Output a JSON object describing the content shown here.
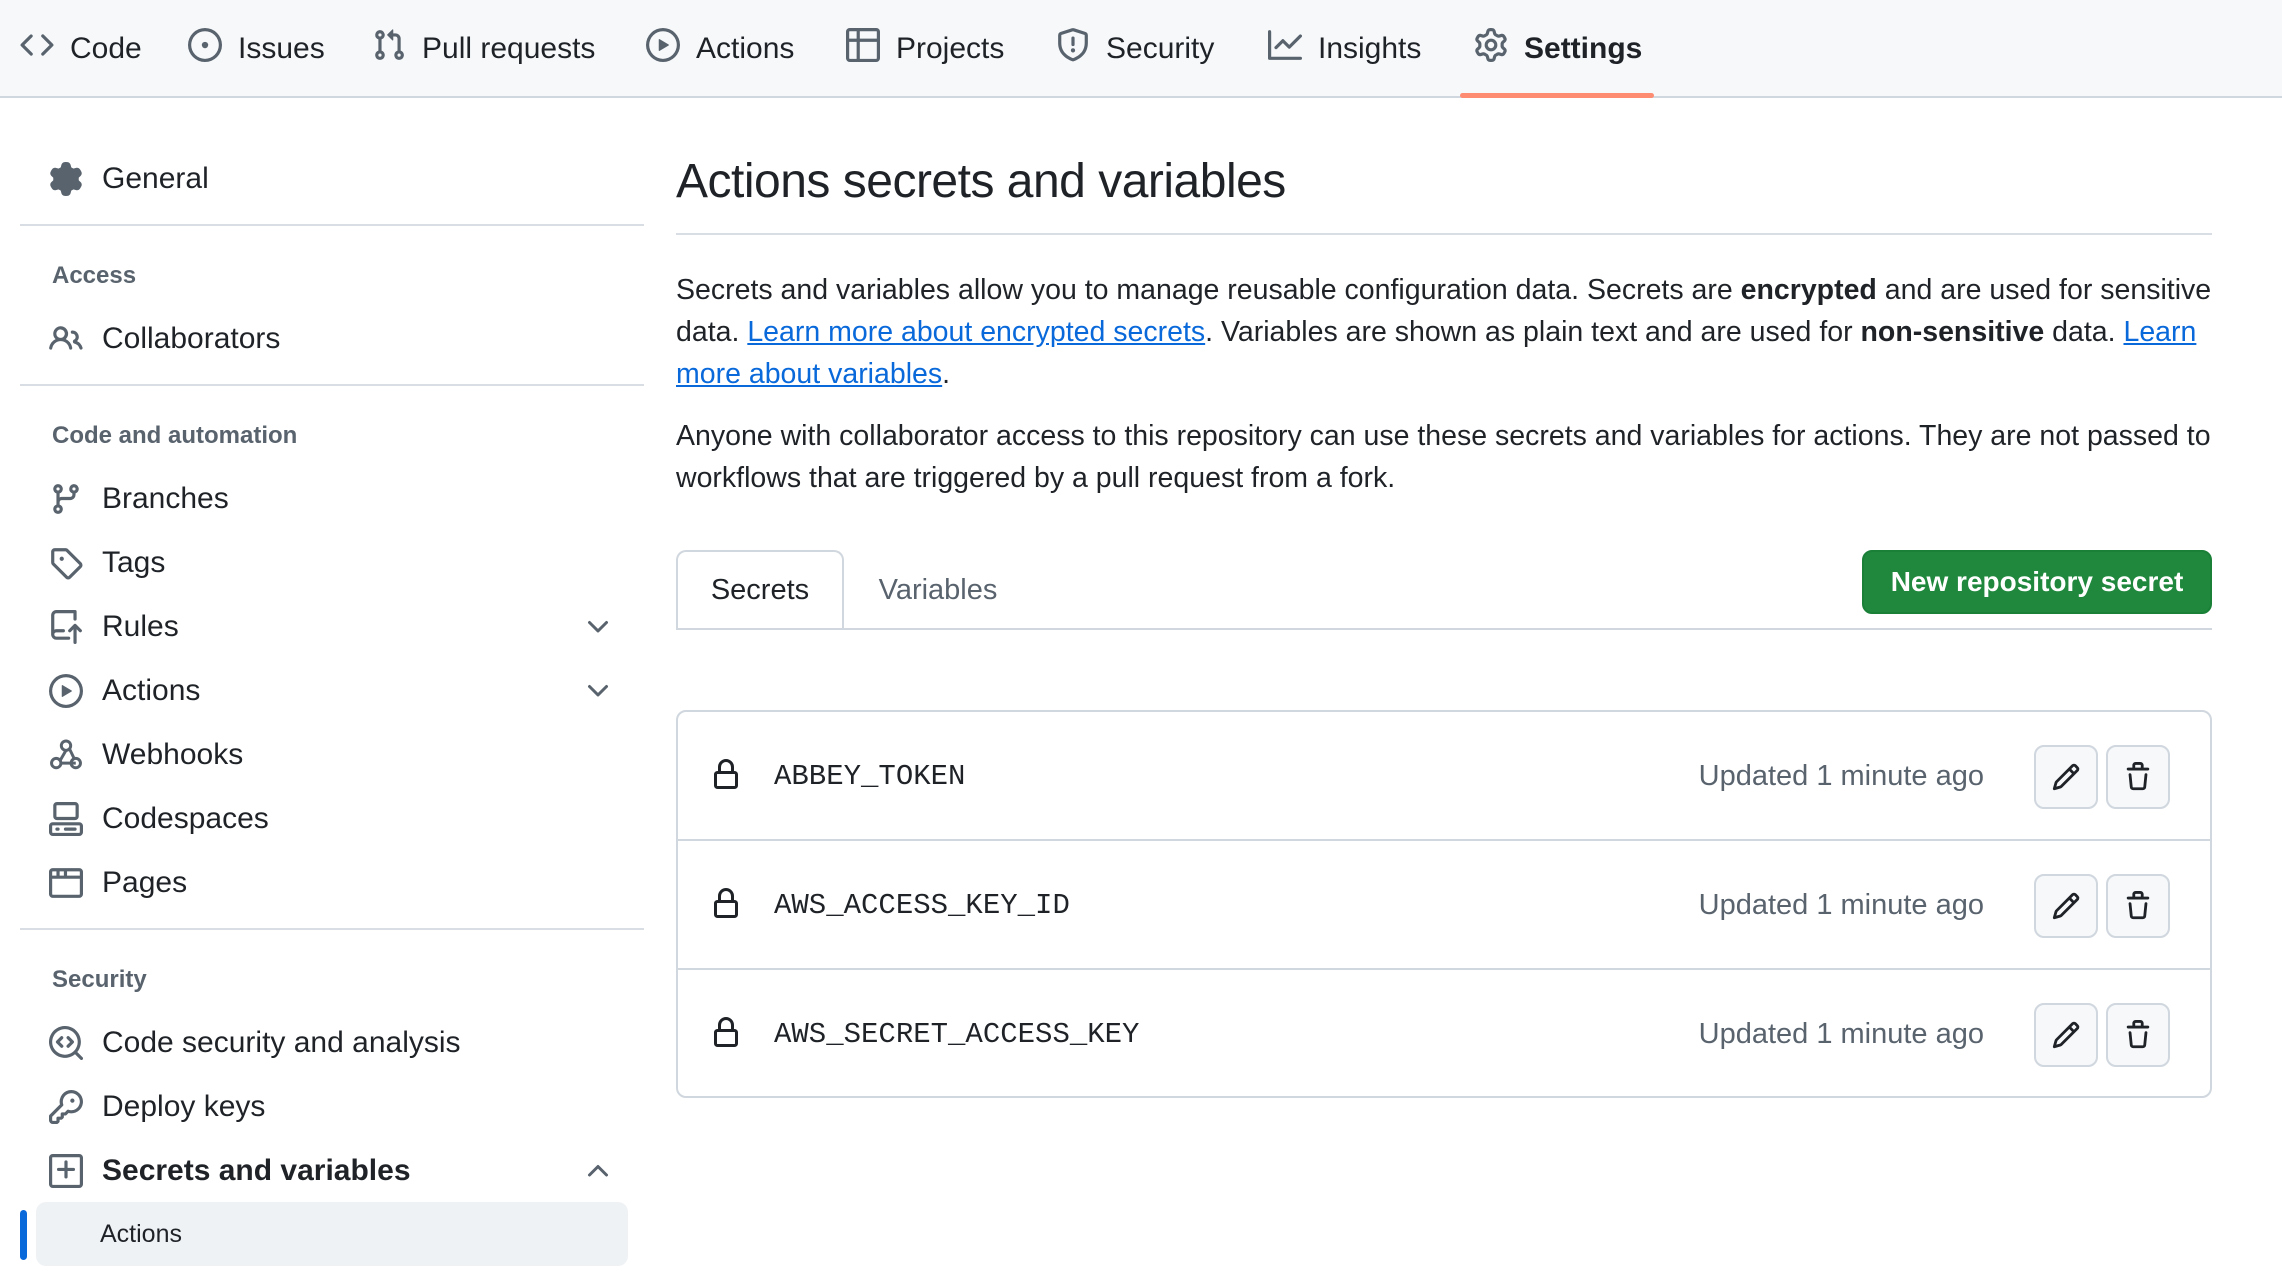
{
  "topnav": {
    "tabs": [
      {
        "label": "Code",
        "icon": "code-icon"
      },
      {
        "label": "Issues",
        "icon": "issue-opened-icon"
      },
      {
        "label": "Pull requests",
        "icon": "git-pull-request-icon"
      },
      {
        "label": "Actions",
        "icon": "play-icon"
      },
      {
        "label": "Projects",
        "icon": "table-icon"
      },
      {
        "label": "Security",
        "icon": "shield-icon"
      },
      {
        "label": "Insights",
        "icon": "graph-icon"
      },
      {
        "label": "Settings",
        "icon": "gear-icon"
      }
    ],
    "selected": "Settings",
    "underline_color": "#fd8c73"
  },
  "sidebar": {
    "general": "General",
    "access_heading": "Access",
    "collaborators": "Collaborators",
    "code_heading": "Code and automation",
    "branches": "Branches",
    "tags": "Tags",
    "rules": "Rules",
    "actions": "Actions",
    "webhooks": "Webhooks",
    "codespaces": "Codespaces",
    "pages": "Pages",
    "security_heading": "Security",
    "code_security": "Code security and analysis",
    "deploy_keys": "Deploy keys",
    "secrets_vars": "Secrets and variables",
    "secrets_actions": "Actions",
    "active_bar_color": "#0969da"
  },
  "main": {
    "title": "Actions secrets and variables",
    "para1": {
      "t1": "Secrets and variables allow you to manage reusable configuration data. Secrets are ",
      "b1": "encrypted",
      "t2": " and are used for sensitive data. ",
      "link1": "Learn more about encrypted secrets",
      "t3": ". Variables are shown as plain text and are used for ",
      "b2": "non-sensitive",
      "t4": " data. ",
      "link2": "Learn more about variables",
      "t5": "."
    },
    "para2": "Anyone with collaborator access to this repository can use these secrets and variables for actions. They are not passed to workflows that are triggered by a pull request from a fork.",
    "tabs": {
      "secrets": "Secrets",
      "variables": "Variables",
      "active": "Secrets"
    },
    "new_button": "New repository secret",
    "button_color": "#1f883d",
    "secrets": [
      {
        "name": "ABBEY_TOKEN",
        "updated": "Updated 1 minute ago"
      },
      {
        "name": "AWS_ACCESS_KEY_ID",
        "updated": "Updated 1 minute ago"
      },
      {
        "name": "AWS_SECRET_ACCESS_KEY",
        "updated": "Updated 1 minute ago"
      }
    ]
  }
}
